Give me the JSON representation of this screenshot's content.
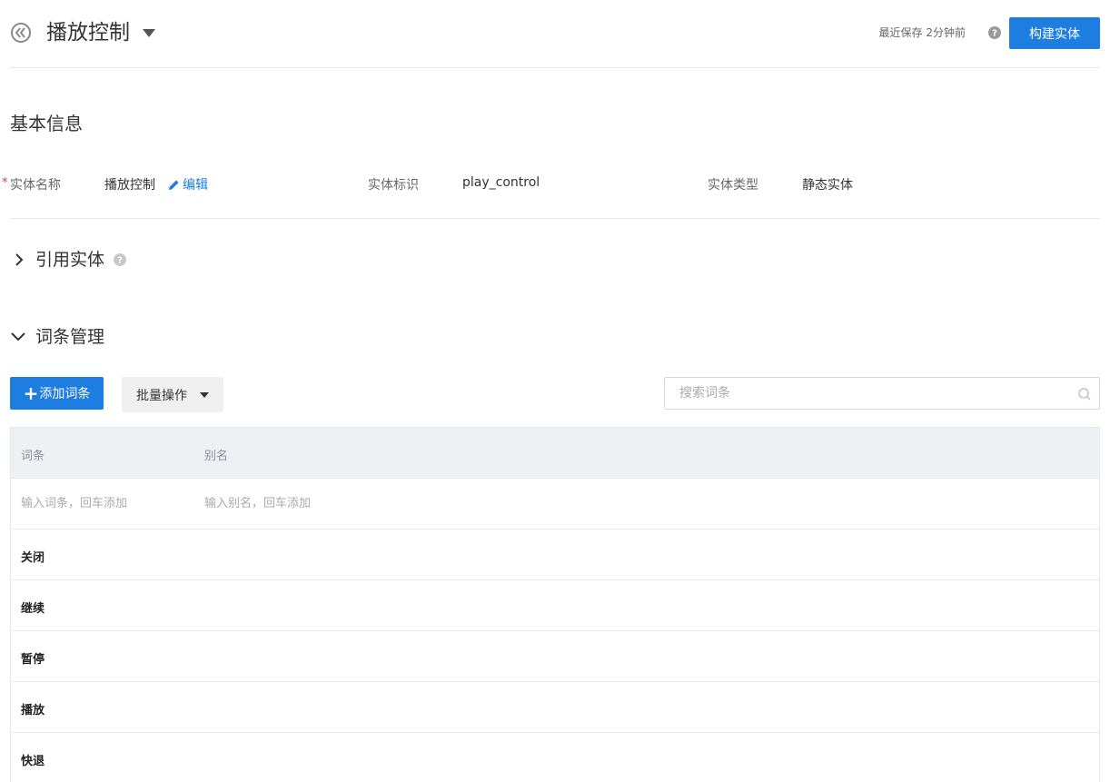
{
  "header": {
    "title": "播放控制",
    "save_status": "最近保存 2分钟前",
    "build_button": "构建实体"
  },
  "basic_info": {
    "section_title": "基本信息",
    "required_mark": "*",
    "name_label": "实体名称",
    "name_value": "播放控制",
    "edit_link": "编辑",
    "id_label": "实体标识",
    "id_value": "play_control",
    "type_label": "实体类型",
    "type_value": "静态实体"
  },
  "reference_section": {
    "title": "引用实体"
  },
  "terms_section": {
    "title": "词条管理",
    "add_button": "添加词条",
    "add_icon": "+",
    "batch_button": "批量操作",
    "search_placeholder": "搜索词条",
    "columns": [
      "词条",
      "别名"
    ],
    "term_input_placeholder": "输入词条，回车添加",
    "alias_input_placeholder": "输入别名，回车添加",
    "rows": [
      {
        "term": "关闭",
        "alias": ""
      },
      {
        "term": "继续",
        "alias": ""
      },
      {
        "term": "暂停",
        "alias": ""
      },
      {
        "term": "播放",
        "alias": ""
      },
      {
        "term": "快退",
        "alias": ""
      }
    ]
  },
  "colors": {
    "primary": "#1e7de0",
    "required": "#e53935",
    "table_header_bg": "#eef1f4"
  },
  "icons": {
    "back": "back-circle-icon",
    "title_caret": "caret-down-icon",
    "help": "question-circle-icon",
    "edit": "pencil-icon",
    "collapsed": "chevron-right-icon",
    "expanded": "chevron-down-icon",
    "search": "search-icon"
  }
}
